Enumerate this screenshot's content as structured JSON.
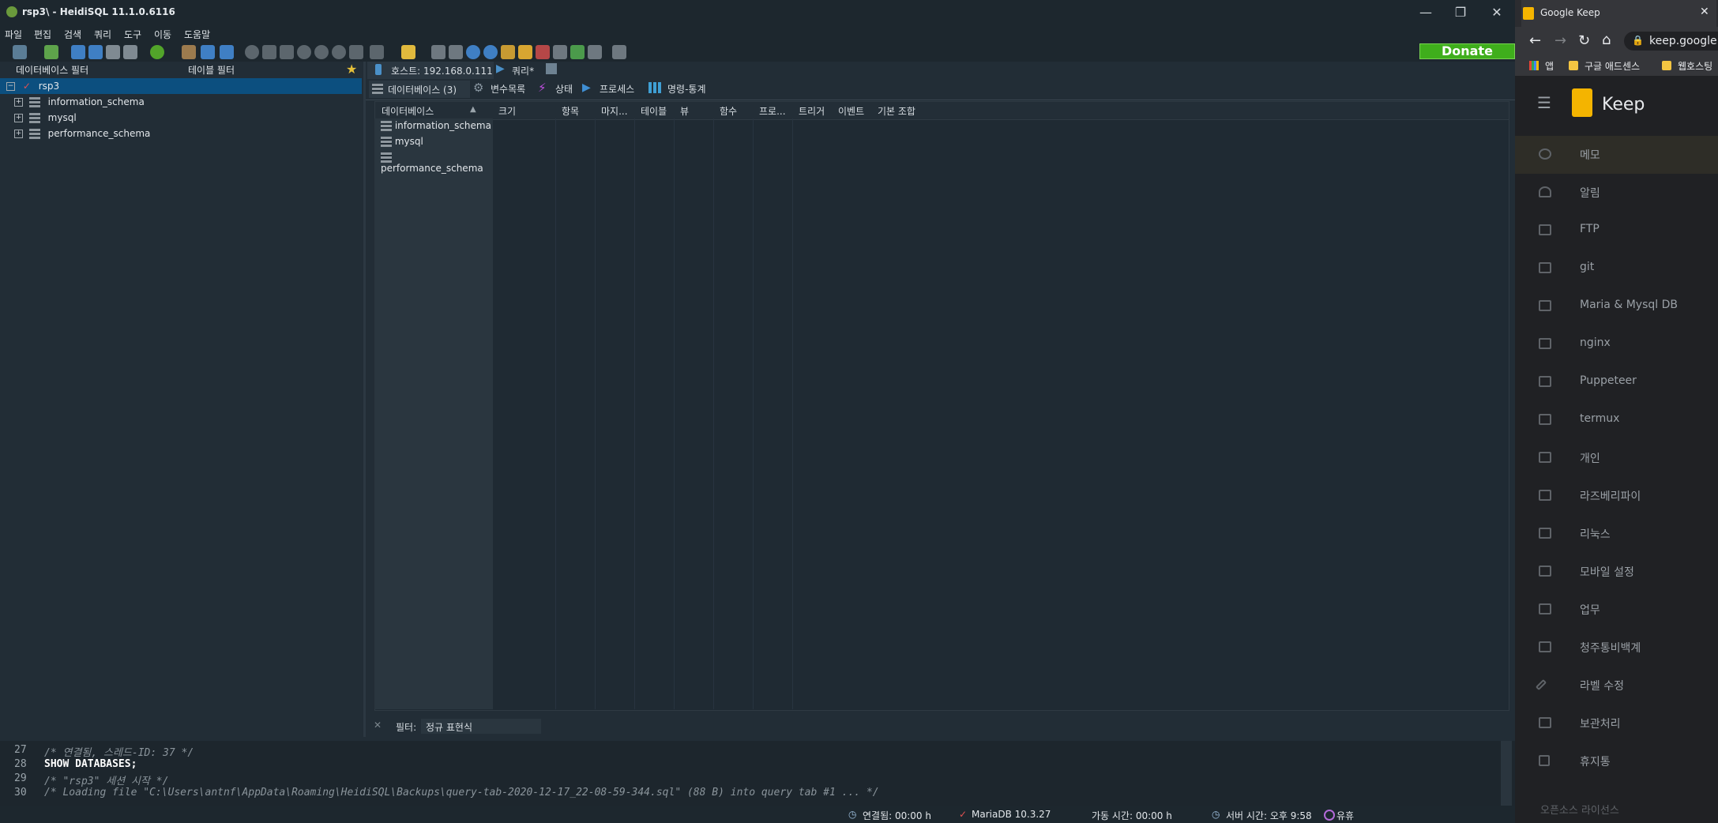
{
  "heidi": {
    "title": "rsp3\\ - HeidiSQL 11.1.0.6116",
    "menu": [
      "파일",
      "편집",
      "검색",
      "쿼리",
      "도구",
      "이동",
      "도움말"
    ],
    "donate": "Donate",
    "db_filter": "데이터베이스 필터",
    "table_filter": "테이블 필터",
    "tree": {
      "root": "rsp3",
      "children": [
        "information_schema",
        "mysql",
        "performance_schema"
      ]
    },
    "host_tab": "호스트: 192.168.0.111",
    "query_tab": "쿼리*",
    "subtabs": [
      "데이터베이스 (3)",
      "변수목록",
      "상태",
      "프로세스",
      "명령-통계"
    ],
    "columns": [
      "데이터베이스",
      "크기",
      "항목",
      "마지...",
      "테이블",
      "뷰",
      "함수",
      "프로...",
      "트리거",
      "이벤트",
      "기본 조합"
    ],
    "rows": [
      "information_schema",
      "mysql",
      "performance_schema"
    ],
    "filter_label": "필터:",
    "filter_value": "정규 표현식",
    "log": [
      {
        "num": "27",
        "text": "/* 연결됨, 스레드-ID: 37 */",
        "type": "comment"
      },
      {
        "num": "28",
        "text": "SHOW DATABASES;",
        "type": "kw"
      },
      {
        "num": "29",
        "text": "/* \"rsp3\" 세션 시작 */",
        "type": "comment"
      },
      {
        "num": "30",
        "text": "/* Loading file \"C:\\Users\\antnf\\AppData\\Roaming\\HeidiSQL\\Backups\\query-tab-2020-12-17_22-08-59-344.sql\" (88 B) into query tab #1 ... */",
        "type": "comment"
      }
    ],
    "status": {
      "connected": "연결됨: 00:00 h",
      "server": "MariaDB 10.3.27",
      "uptime": "가동 시간: 00:00 h",
      "server_time": "서버 시간: 오후 9:58",
      "idle": "유휴"
    }
  },
  "chrome": {
    "tab_title": "Google Keep",
    "url": "keep.google.",
    "bookmarks": [
      "앱",
      "구글 애드센스",
      "웹호스팅"
    ],
    "app_name": "Keep",
    "nav": [
      "메모",
      "알림",
      "FTP",
      "git",
      "Maria & Mysql DB",
      "nginx",
      "Puppeteer",
      "termux",
      "개인",
      "라즈베리파이",
      "리눅스",
      "모바일 설정",
      "업무",
      "청주통비백계",
      "라벨 수정",
      "보관처리",
      "휴지통"
    ],
    "footer": "오픈소스 라이선스"
  }
}
